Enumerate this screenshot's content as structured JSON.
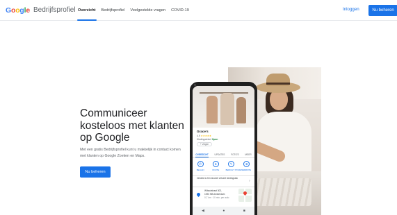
{
  "header": {
    "logo_letters": [
      "G",
      "o",
      "o",
      "g",
      "l",
      "e"
    ],
    "product_name": "Bedrijfsprofiel",
    "nav_tabs": [
      {
        "label": "Overzicht",
        "active": true
      },
      {
        "label": "Bedrijfsprofiel",
        "active": false
      },
      {
        "label": "Veelgestelde vragen",
        "active": false
      },
      {
        "label": "COVID-19",
        "active": false
      }
    ],
    "login_label": "Inloggen",
    "cta_label": "Nu beheren"
  },
  "hero": {
    "title": "Communiceer kosteloos met klanten op Google",
    "description": "Met een gratis Bedrijfsprofiel kunt u makkelijk in contact komen met klanten op Google Zoeken en Maps.",
    "cta_label": "Nu beheren"
  },
  "phone": {
    "business_name": "Grace's",
    "rating": "4.9",
    "stars": "★★★★★",
    "category": "Kledingwinkel",
    "open_status": "Open",
    "follow_label": "+ Volgen",
    "tabs": [
      {
        "label": "OVERZICHT",
        "active": true
      },
      {
        "label": "UPDATES",
        "active": false
      },
      {
        "label": "FOTO'S",
        "active": false
      },
      {
        "label": "MEER",
        "active": false
      }
    ],
    "actions": [
      {
        "icon": "phone-icon",
        "glyph": "✆",
        "label": "BELLEN"
      },
      {
        "icon": "directions-icon",
        "glyph": "➤",
        "label": "ROUTE"
      },
      {
        "icon": "booking-icon",
        "glyph": "✎",
        "label": "BERICHT STUREN"
      },
      {
        "icon": "website-icon",
        "glyph": "⊕",
        "label": "WEBSITE"
      }
    ],
    "info_text": "Ontdek is één favoriet virtueel kledingstuk",
    "address_line1": "Wibautstraat 302,",
    "address_line2": "1093 NB Amsterdam",
    "address_sub": "0,7 km · 10 min. per auto"
  },
  "colors": {
    "accent": "#1a73e8",
    "open_status": "#188038",
    "stars": "#fbbc05"
  }
}
